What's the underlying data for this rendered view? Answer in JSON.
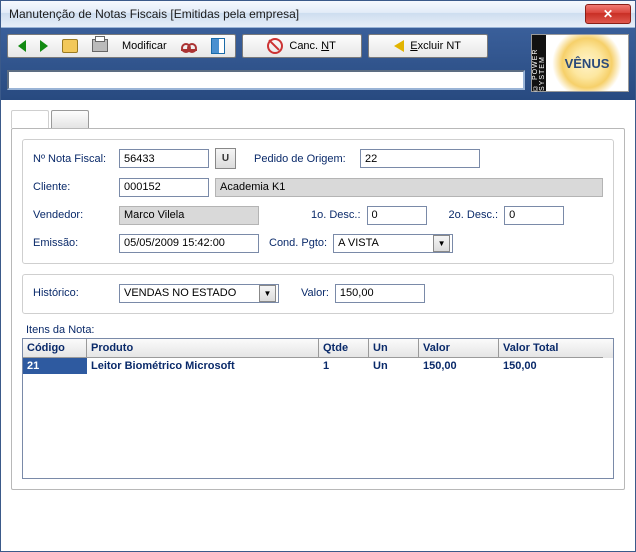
{
  "window": {
    "title": "Manutenção de Notas Fiscais [Emitidas pela empresa]"
  },
  "toolbar": {
    "modify_label": "Modificar",
    "canc_label_pre": "Canc. ",
    "canc_label_und": "N",
    "canc_label_post": "T",
    "excl_label_pre": "",
    "excl_label_und": "E",
    "excl_label_post": "xcluir NT"
  },
  "logo": {
    "strip": "© POWER SYSTEM",
    "brand": "VÊNUS"
  },
  "form": {
    "nota_label": "Nº Nota Fiscal:",
    "nota_value": "56433",
    "u_label": "U",
    "pedido_label": "Pedido de Origem:",
    "pedido_value": "22",
    "cliente_label": "Cliente:",
    "cliente_code": "000152",
    "cliente_name": "Academia K1",
    "vendedor_label": "Vendedor:",
    "vendedor_value": "Marco Vilela",
    "desc1_label": "1o. Desc.:",
    "desc1_value": "0",
    "desc2_label": "2o. Desc.:",
    "desc2_value": "0",
    "emissao_label": "Emissão:",
    "emissao_value": "05/05/2009 15:42:00",
    "cond_label": "Cond. Pgto:",
    "cond_value": "A VISTA",
    "historico_label": "Histórico:",
    "historico_value": "VENDAS NO ESTADO",
    "valor_label": "Valor:",
    "valor_value": "150,00"
  },
  "items": {
    "title": "Itens da Nota:",
    "headers": {
      "code": "Código",
      "prod": "Produto",
      "qt": "Qtde",
      "un": "Un",
      "val": "Valor",
      "vt": "Valor Total"
    },
    "rows": [
      {
        "code": "21",
        "prod": "Leitor Biométrico Microsoft",
        "qt": "1",
        "un": "Un",
        "val": "150,00",
        "vt": "150,00"
      }
    ]
  }
}
